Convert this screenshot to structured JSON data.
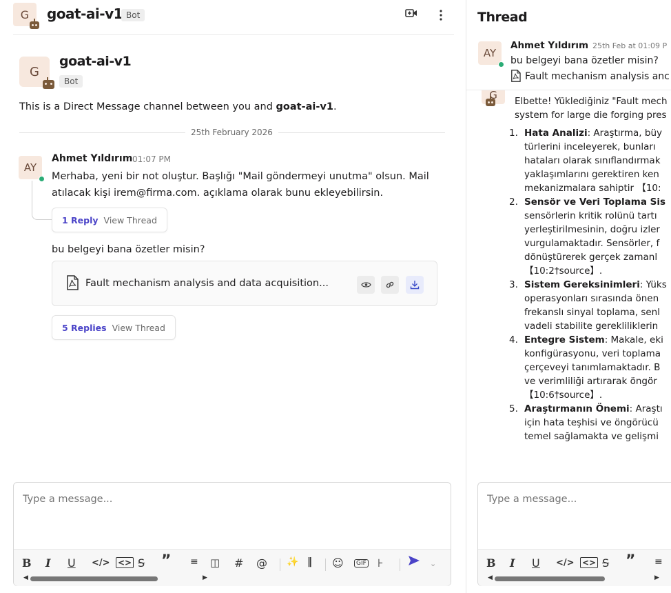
{
  "left": {
    "header": {
      "avatar_letter": "G",
      "title": "goat-ai-v1",
      "badge": "Bot",
      "video_icon": "video-icon",
      "more_icon": "more-vertical-icon"
    },
    "intro": {
      "avatar_letter": "G",
      "name": "goat-ai-v1",
      "badge": "Bot",
      "text_prefix": "This is a Direct Message channel between you and ",
      "text_bold": "goat-ai-v1",
      "text_suffix": "."
    },
    "date_divider": "25th February 2026",
    "message1": {
      "avatar": "AY",
      "name": "Ahmet Yıldırım",
      "time": "01:07 PM",
      "line1": "Merhaba, yeni bir not oluştur. Başlığı \"Mail göndermeyi unutma\" olsun. Mail",
      "line2": "atılacak kişi irem@firma.com. açıklama olarak bunu ekleyebilirsin."
    },
    "thread1": {
      "count": "1 Reply",
      "view": "View Thread"
    },
    "message2": {
      "text": "bu belgeyi bana özetler misin?",
      "file_name": "Fault mechanism analysis and data acquisition..."
    },
    "thread2": {
      "count": "5 Replies",
      "view": "View Thread"
    },
    "composer": {
      "placeholder": "Type a message..."
    }
  },
  "right": {
    "title": "Thread",
    "parent": {
      "avatar": "AY",
      "name": "Ahmet Yıldırım",
      "time": "25th Feb at 01:09 P",
      "text": "bu belgeyi bana özetler misin?",
      "file": "Fault mechanism analysis anc"
    },
    "bot_avatar": "G",
    "reply_intro": [
      "Elbette! Yüklediğiniz \"Fault mech",
      "system for large die forging pres"
    ],
    "items": [
      {
        "num": "1.",
        "bold": "Hata Analizi",
        "rest": ": Araştırma, büy",
        "lines": [
          "türlerini inceleyerek, bunları",
          "hataları olarak sınıflandırmak",
          "yaklaşımlarını gerektiren ken",
          "mekanizmalara sahiptir 【10:"
        ]
      },
      {
        "num": "2.",
        "bold": "Sensör ve Veri Toplama Sis",
        "rest": "",
        "lines": [
          "sensörlerin kritik rolünü tartı",
          "yerleştirilmesinin, doğru izler",
          "vurgulamaktadır. Sensörler, f",
          "dönüştürerek gerçek zamanl",
          "【10:2†source】."
        ]
      },
      {
        "num": "3.",
        "bold": "Sistem Gereksinimleri",
        "rest": ": Yüks",
        "lines": [
          "operasyonları sırasında önen",
          "frekanslı sinyal toplama, senl",
          "vadeli stabilite gerekliliklerin"
        ]
      },
      {
        "num": "4.",
        "bold": "Entegre Sistem",
        "rest": ": Makale, eki",
        "lines": [
          "konfigürasyonu, veri toplama",
          "çerçeveyi tanımlamaktadır. B",
          "ve verimliliği artırarak öngör",
          "【10:6†source】."
        ]
      },
      {
        "num": "5.",
        "bold": "Araştırmanın Önemi",
        "rest": ": Araştı",
        "lines": [
          "için hata teşhisi ve öngörücü",
          "temel sağlamakta ve gelişmi"
        ]
      }
    ],
    "composer": {
      "placeholder": "Type a message..."
    }
  },
  "colors": {
    "accent": "#4b44c8",
    "online": "#2bac76",
    "avatar_bg": "#f7e8de"
  }
}
